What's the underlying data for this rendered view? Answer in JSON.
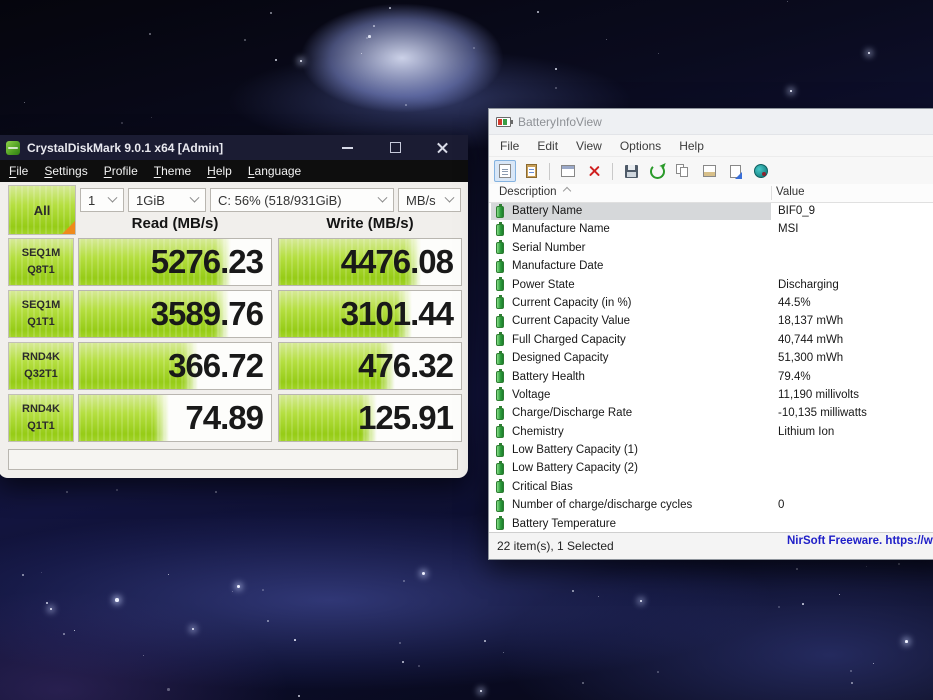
{
  "colors": {
    "cdm_green": "#a2d427",
    "cdm_orange": "#ef8a1b",
    "cdm_titlebar": "#1b1c33",
    "nirsoft_link_blue": "#2020c8",
    "battery_icon_green": "#3a9e46"
  },
  "cdm": {
    "title": "CrystalDiskMark 9.0.1 x64 [Admin]",
    "menu": [
      "File",
      "Settings",
      "Profile",
      "Theme",
      "Help",
      "Language"
    ],
    "all_button": "All",
    "combos": [
      "1",
      "1GiB",
      "C: 56% (518/931GiB)",
      "MB/s"
    ],
    "read_header": "Read (MB/s)",
    "write_header": "Write (MB/s)",
    "unit": "MB/s",
    "results": [
      {
        "test": "SEQ1M",
        "queue_thread": "Q8T1",
        "read": "5276.23",
        "write": "4476.08",
        "read_fill_pct": 79,
        "write_fill_pct": 78
      },
      {
        "test": "SEQ1M",
        "queue_thread": "Q1T1",
        "read": "3589.76",
        "write": "3101.44",
        "read_fill_pct": 78,
        "write_fill_pct": 73
      },
      {
        "test": "RND4K",
        "queue_thread": "Q32T1",
        "read": "366.72",
        "write": "476.32",
        "read_fill_pct": 62,
        "write_fill_pct": 64
      },
      {
        "test": "RND4K",
        "queue_thread": "Q1T1",
        "read": "74.89",
        "write": "125.91",
        "read_fill_pct": 47,
        "write_fill_pct": 54
      }
    ]
  },
  "biv": {
    "title": "BatteryInfoView",
    "menu": [
      "File",
      "Edit",
      "View",
      "Options",
      "Help"
    ],
    "columns": [
      "Description",
      "Value"
    ],
    "rows": [
      {
        "label": "Battery Name",
        "value": "BIF0_9",
        "selected": true
      },
      {
        "label": "Manufacture Name",
        "value": "MSI",
        "selected": false
      },
      {
        "label": "Serial Number",
        "value": "",
        "selected": false
      },
      {
        "label": "Manufacture Date",
        "value": "",
        "selected": false
      },
      {
        "label": "Power State",
        "value": "Discharging",
        "selected": false
      },
      {
        "label": "Current Capacity (in %)",
        "value": "44.5%",
        "selected": false
      },
      {
        "label": "Current Capacity Value",
        "value": "18,137 mWh",
        "selected": false
      },
      {
        "label": "Full Charged Capacity",
        "value": "40,744 mWh",
        "selected": false
      },
      {
        "label": "Designed Capacity",
        "value": "51,300 mWh",
        "selected": false
      },
      {
        "label": "Battery Health",
        "value": "79.4%",
        "selected": false
      },
      {
        "label": "Voltage",
        "value": "11,190 millivolts",
        "selected": false
      },
      {
        "label": "Charge/Discharge Rate",
        "value": "-10,135 milliwatts",
        "selected": false
      },
      {
        "label": "Chemistry",
        "value": "Lithium Ion",
        "selected": false
      },
      {
        "label": "Low Battery Capacity (1)",
        "value": "",
        "selected": false
      },
      {
        "label": "Low Battery Capacity (2)",
        "value": "",
        "selected": false
      },
      {
        "label": "Critical Bias",
        "value": "",
        "selected": false
      },
      {
        "label": "Number of charge/discharge cycles",
        "value": "0",
        "selected": false
      },
      {
        "label": "Battery Temperature",
        "value": "",
        "selected": false
      }
    ],
    "status_left": "22 item(s), 1 Selected",
    "status_right": "NirSoft Freeware. https://www"
  }
}
